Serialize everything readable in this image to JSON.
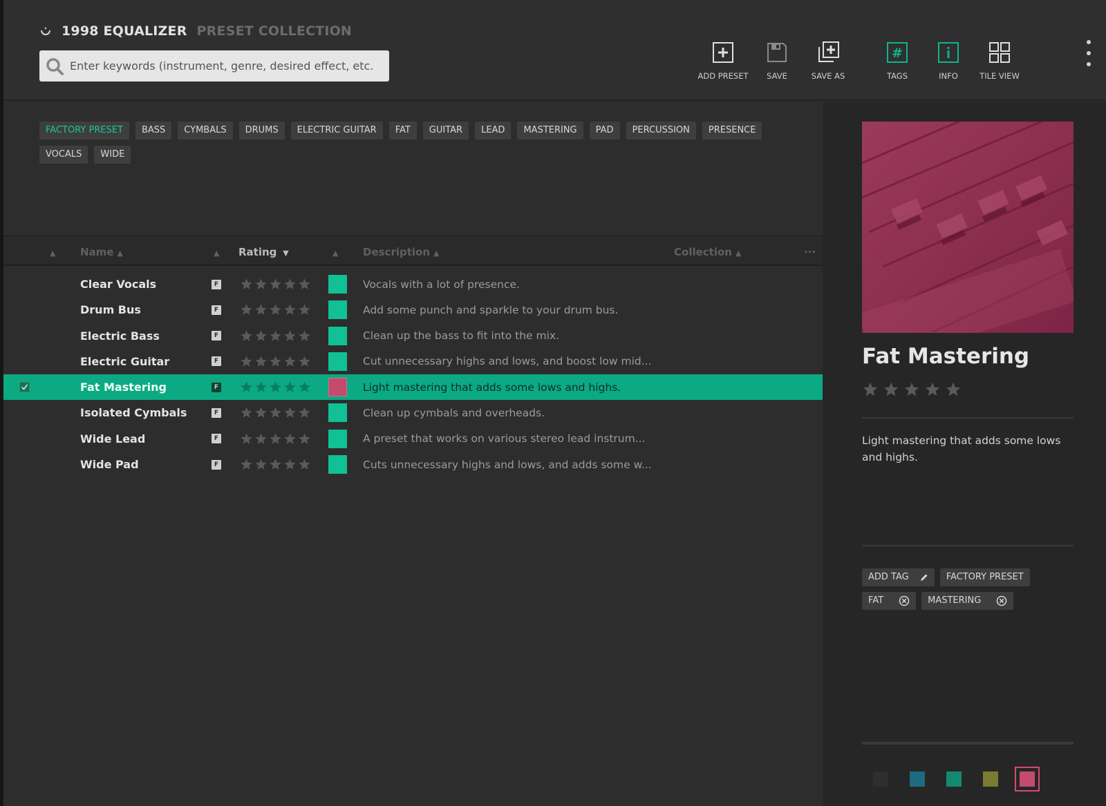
{
  "app": {
    "title": "1998 EQUALIZER",
    "subtitle": "PRESET COLLECTION"
  },
  "search": {
    "placeholder": "Enter keywords (instrument, genre, desired effect, etc.)",
    "value": ""
  },
  "toolbar": {
    "add_preset": "ADD PRESET",
    "save": "SAVE",
    "save_as": "SAVE AS",
    "tags": "TAGS",
    "info": "INFO",
    "tile_view": "TILE VIEW"
  },
  "tags": [
    "FACTORY PRESET",
    "BASS",
    "CYMBALS",
    "DRUMS",
    "ELECTRIC GUITAR",
    "FAT",
    "GUITAR",
    "LEAD",
    "MASTERING",
    "PAD",
    "PERCUSSION",
    "PRESENCE",
    "VOCALS",
    "WIDE"
  ],
  "table": {
    "headers": {
      "name": "Name",
      "rating": "Rating",
      "description": "Description",
      "collection": "Collection",
      "more": "···"
    },
    "rows": [
      {
        "name": "Clear Vocals",
        "badge": "F",
        "rating": 0,
        "color": "#11c095",
        "description": "Vocals with a lot of presence.",
        "selected": false
      },
      {
        "name": "Drum Bus",
        "badge": "F",
        "rating": 0,
        "color": "#11c095",
        "description": "Add some punch and sparkle to your drum bus.",
        "selected": false
      },
      {
        "name": "Electric Bass",
        "badge": "F",
        "rating": 0,
        "color": "#11c095",
        "description": "Clean up the bass to fit into the mix.",
        "selected": false
      },
      {
        "name": "Electric Guitar",
        "badge": "F",
        "rating": 0,
        "color": "#11c095",
        "description": "Cut unnecessary highs and lows, and boost low mid...",
        "selected": false
      },
      {
        "name": "Fat Mastering",
        "badge": "F",
        "rating": 0,
        "color": "#c44a6e",
        "description": "Light mastering that adds some lows and highs.",
        "selected": true
      },
      {
        "name": "Isolated Cymbals",
        "badge": "F",
        "rating": 0,
        "color": "#11c095",
        "description": "Clean up cymbals and overheads.",
        "selected": false
      },
      {
        "name": "Wide Lead",
        "badge": "F",
        "rating": 0,
        "color": "#11c095",
        "description": "A preset that works on various stereo lead instrum...",
        "selected": false
      },
      {
        "name": "Wide Pad",
        "badge": "F",
        "rating": 0,
        "color": "#11c095",
        "description": "Cuts unnecessary highs and lows, and adds some w...",
        "selected": false
      }
    ]
  },
  "detail": {
    "title": "Fat Mastering",
    "rating": 0,
    "description": "Light mastering that adds some lows and highs.",
    "add_tag": "ADD TAG",
    "tags": [
      "FACTORY PRESET",
      "FAT",
      "MASTERING"
    ],
    "colors": [
      "#2e2e2e",
      "#1e6a80",
      "#138a70",
      "#7a7a30",
      "#c44a6e"
    ],
    "selected_color": "#c44a6e"
  },
  "colors": {
    "accent": "#0baa82",
    "tag_active": "#1cc69c"
  }
}
